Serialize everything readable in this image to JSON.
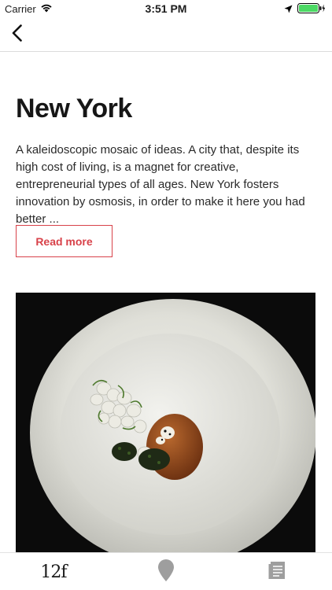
{
  "status_bar": {
    "carrier": "Carrier",
    "time": "3:51 PM",
    "wifi_icon": "wifi-icon",
    "location_icon": "location-arrow-icon",
    "battery_icon": "battery-charging-icon",
    "battery_color": "#4cd964"
  },
  "nav": {
    "back_icon": "chevron-left-icon"
  },
  "article": {
    "title": "New York",
    "description": "A kaleidoscopic mosaic of ideas. A city that, despite its high cost of living, is a magnet for creative, entrepreneurial types of all ages. New York fosters innovation by osmosis, in order to make it here you had better ...",
    "read_more_label": "Read more",
    "accent_color": "#d8424a",
    "image": "plated-dish-photo"
  },
  "tab_bar": {
    "tabs": [
      {
        "label": "12f",
        "icon": "brand-logo-icon"
      },
      {
        "icon": "map-pin-icon"
      },
      {
        "icon": "document-list-icon"
      }
    ]
  }
}
